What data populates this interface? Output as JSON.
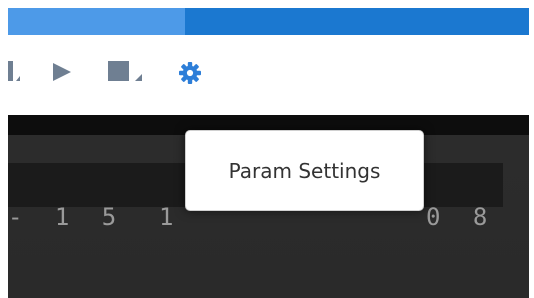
{
  "tooltip": {
    "text": "Param Settings"
  },
  "display": {
    "left_digits": "- 1 5",
    "middle_digit": "1",
    "right_digits": "0 8"
  },
  "toolbar": {
    "icons": [
      "stop-partial-icon",
      "play-icon",
      "stop-icon",
      "gear-icon"
    ]
  },
  "colors": {
    "title_bar": "#1b78d0",
    "title_bar_segment": "#4d9ae8",
    "toolbar_icon": "#6f7f92",
    "gear_icon": "#2d7ed8",
    "display_bg": "#2c2c2c",
    "lcd_bg": "#1b1b1b",
    "lcd_text": "#9a9a9a"
  }
}
